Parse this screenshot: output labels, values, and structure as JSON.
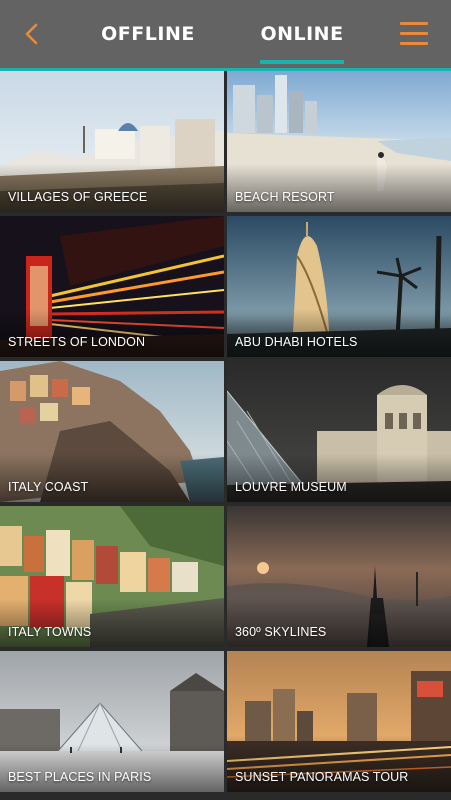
{
  "header": {
    "tabs": [
      {
        "label": "OFFLINE"
      },
      {
        "label": "ONLINE"
      }
    ],
    "active_tab": "ONLINE"
  },
  "colors": {
    "accent": "#e98a3a",
    "active_underline": "#16b3b0",
    "header_bg": "#636363"
  },
  "icons": {
    "back": "chevron-left-icon",
    "menu": "hamburger-menu-icon"
  },
  "tours": [
    {
      "label": "VILLAGES OF GREECE"
    },
    {
      "label": "BEACH RESORT"
    },
    {
      "label": "STREETS OF LONDON"
    },
    {
      "label": "ABU DHABI HOTELS"
    },
    {
      "label": "ITALY COAST"
    },
    {
      "label": "LOUVRE MUSEUM"
    },
    {
      "label": "ITALY TOWNS"
    },
    {
      "label": "360º SKYLINES"
    },
    {
      "label": "BEST PLACES IN PARIS"
    },
    {
      "label": "SUNSET PANORAMAS TOUR"
    }
  ]
}
